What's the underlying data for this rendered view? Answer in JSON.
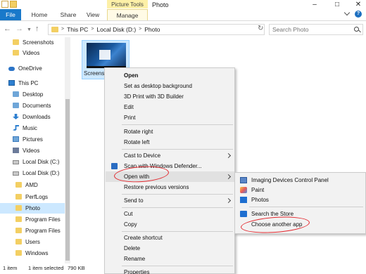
{
  "window": {
    "title": "Photo",
    "contextual_group": "Picture Tools",
    "minimize": "–",
    "maximize": "□",
    "close": "✕"
  },
  "ribbon": {
    "tabs": [
      {
        "label": "File"
      },
      {
        "label": "Home"
      },
      {
        "label": "Share"
      },
      {
        "label": "View"
      },
      {
        "label": "Manage"
      }
    ],
    "help": "?"
  },
  "address": {
    "back": "←",
    "forward": "→",
    "dropdown": "▼",
    "up": "↑",
    "crumbs": [
      "This PC",
      "Local Disk (D:)",
      "Photo"
    ],
    "separator": ">",
    "refresh": "↻"
  },
  "search": {
    "placeholder": "Search Photo"
  },
  "nav_pane": {
    "items": [
      {
        "label": "Screenshots",
        "icon": "folder-icon"
      },
      {
        "label": "Videos",
        "icon": "folder-icon"
      },
      {
        "label": "OneDrive",
        "icon": "cloud-icon"
      },
      {
        "label": "This PC",
        "icon": "computer-icon"
      },
      {
        "label": "Desktop",
        "icon": "desktop-icon"
      },
      {
        "label": "Documents",
        "icon": "documents-icon"
      },
      {
        "label": "Downloads",
        "icon": "download-icon"
      },
      {
        "label": "Music",
        "icon": "music-icon"
      },
      {
        "label": "Pictures",
        "icon": "pictures-icon"
      },
      {
        "label": "Videos",
        "icon": "videos-icon"
      },
      {
        "label": "Local Disk (C:)",
        "icon": "drive-icon"
      },
      {
        "label": "Local Disk (D:)",
        "icon": "drive-icon"
      },
      {
        "label": "AMD",
        "icon": "folder-icon"
      },
      {
        "label": "PerfLogs",
        "icon": "folder-icon"
      },
      {
        "label": "Photo",
        "icon": "folder-icon",
        "selected": true
      },
      {
        "label": "Program Files",
        "icon": "folder-icon"
      },
      {
        "label": "Program Files (",
        "icon": "folder-icon"
      },
      {
        "label": "Users",
        "icon": "folder-icon"
      },
      {
        "label": "Windows",
        "icon": "folder-icon"
      }
    ]
  },
  "file": {
    "name": "Screensh"
  },
  "status": {
    "count": "1 item",
    "selected": "1 item selected",
    "size": "790 KB"
  },
  "context_menu": {
    "items": [
      {
        "label": "Open",
        "bold": true
      },
      {
        "label": "Set as desktop background"
      },
      {
        "label": "3D Print with 3D Builder"
      },
      {
        "label": "Edit"
      },
      {
        "label": "Print"
      },
      {
        "label": "Rotate right"
      },
      {
        "label": "Rotate left"
      },
      {
        "label": "Cast to Device",
        "submenu": true
      },
      {
        "label": "Scan with Windows Defender...",
        "icon": "defender-shield-icon"
      },
      {
        "label": "Open with",
        "submenu": true,
        "highlighted": true
      },
      {
        "label": "Restore previous versions"
      },
      {
        "label": "Send to",
        "submenu": true
      },
      {
        "label": "Cut"
      },
      {
        "label": "Copy"
      },
      {
        "label": "Create shortcut"
      },
      {
        "label": "Delete"
      },
      {
        "label": "Rename"
      },
      {
        "label": "Properties"
      }
    ]
  },
  "open_with_submenu": {
    "items": [
      {
        "label": "Imaging Devices Control Panel",
        "icon": "scanner-icon"
      },
      {
        "label": "Paint",
        "icon": "paint-icon"
      },
      {
        "label": "Photos",
        "icon": "photos-icon"
      },
      {
        "label": "Search the Store",
        "icon": "store-icon"
      },
      {
        "label": "Choose another app"
      }
    ]
  },
  "colors": {
    "accent": "#1979ca",
    "selection": "#cce8ff",
    "annotation": "#e3282e",
    "picture_tools": "#fdf0a7"
  }
}
